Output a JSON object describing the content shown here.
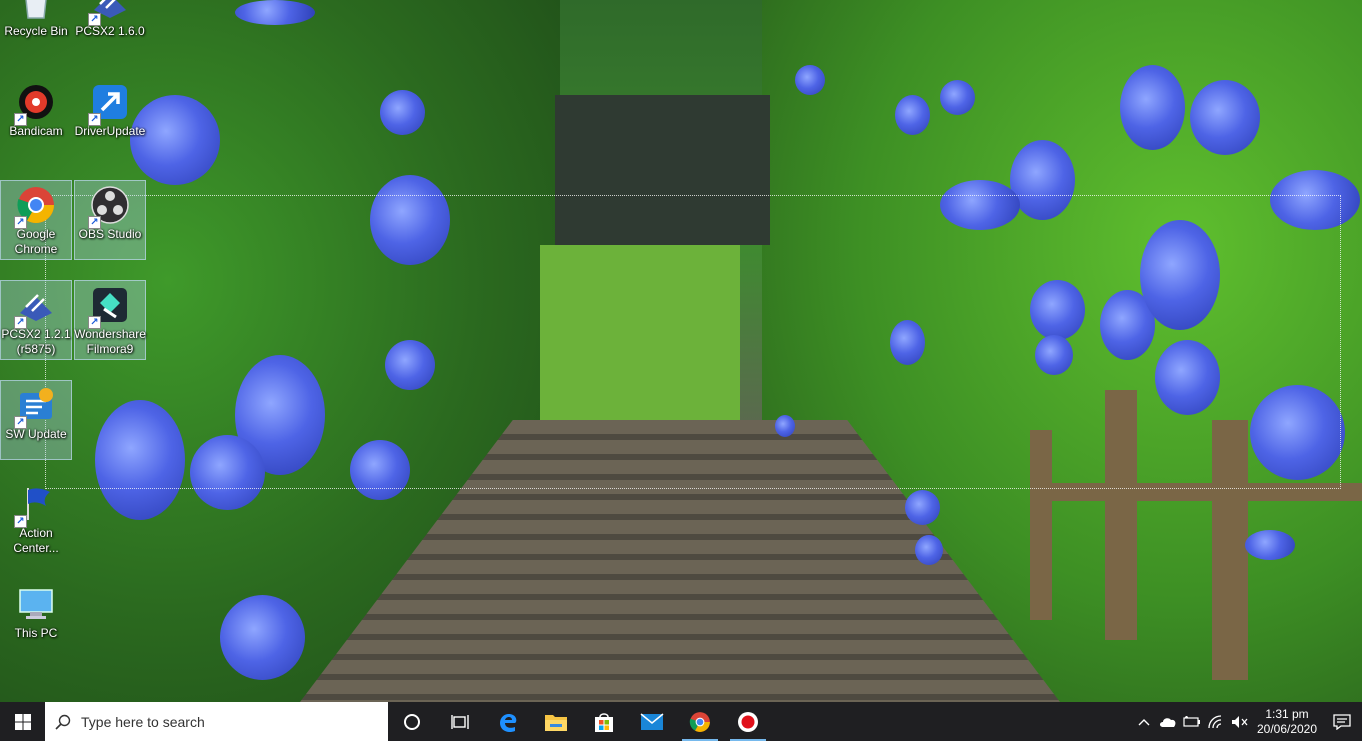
{
  "desktop": {
    "icons": [
      {
        "id": "recycle-bin",
        "label": "Recycle Bin",
        "shortcut": false,
        "selected": false,
        "icon": "recycle-bin-icon"
      },
      {
        "id": "pcsx2-160",
        "label": "PCSX2 1.6.0",
        "shortcut": true,
        "selected": false,
        "icon": "pcsx2-icon"
      },
      {
        "id": "bandicam",
        "label": "Bandicam",
        "shortcut": true,
        "selected": false,
        "icon": "bandicam-icon"
      },
      {
        "id": "driverupdate",
        "label": "DriverUpdate",
        "shortcut": true,
        "selected": false,
        "icon": "driverupdate-icon"
      },
      {
        "id": "google-chrome",
        "label": "Google Chrome",
        "shortcut": true,
        "selected": true,
        "icon": "chrome-icon"
      },
      {
        "id": "obs-studio",
        "label": "OBS Studio",
        "shortcut": true,
        "selected": true,
        "icon": "obs-icon"
      },
      {
        "id": "pcsx2-121",
        "label": "PCSX2 1.2.1 (r5875)",
        "shortcut": true,
        "selected": true,
        "icon": "pcsx2-icon"
      },
      {
        "id": "filmora9",
        "label": "Wondershare Filmora9",
        "shortcut": true,
        "selected": true,
        "icon": "filmora-icon"
      },
      {
        "id": "sw-update",
        "label": "SW Update",
        "shortcut": true,
        "selected": true,
        "icon": "sw-update-icon"
      },
      {
        "id": "action-center",
        "label": "Action Center...",
        "shortcut": true,
        "selected": false,
        "icon": "action-center-flag-icon"
      },
      {
        "id": "this-pc",
        "label": "This PC",
        "shortcut": false,
        "selected": false,
        "icon": "this-pc-icon"
      }
    ]
  },
  "taskbar": {
    "search_placeholder": "Type here to search",
    "pinned": [
      {
        "name": "cortana-button",
        "icon": "cortana-circle-icon",
        "active": false
      },
      {
        "name": "task-view-button",
        "icon": "task-view-icon",
        "active": false
      },
      {
        "name": "edge-button",
        "icon": "edge-icon",
        "active": false
      },
      {
        "name": "file-explorer-button",
        "icon": "folder-icon",
        "active": false
      },
      {
        "name": "store-button",
        "icon": "store-bag-icon",
        "active": false
      },
      {
        "name": "mail-button",
        "icon": "mail-icon",
        "active": false
      },
      {
        "name": "chrome-taskbar-button",
        "icon": "chrome-icon",
        "active": true
      },
      {
        "name": "bandicam-taskbar-button",
        "icon": "record-icon",
        "active": true
      }
    ],
    "tray": {
      "icons": [
        "chevron-up-icon",
        "cloud-icon",
        "battery-icon",
        "wifi-icon",
        "mute-icon"
      ],
      "time": "1:31 pm",
      "date": "20/06/2020",
      "notification_icon": "notification-icon"
    }
  },
  "colors": {
    "taskbar": "#1f1f22",
    "accent": "#76b9ed",
    "selection": "#b4d2f0"
  }
}
